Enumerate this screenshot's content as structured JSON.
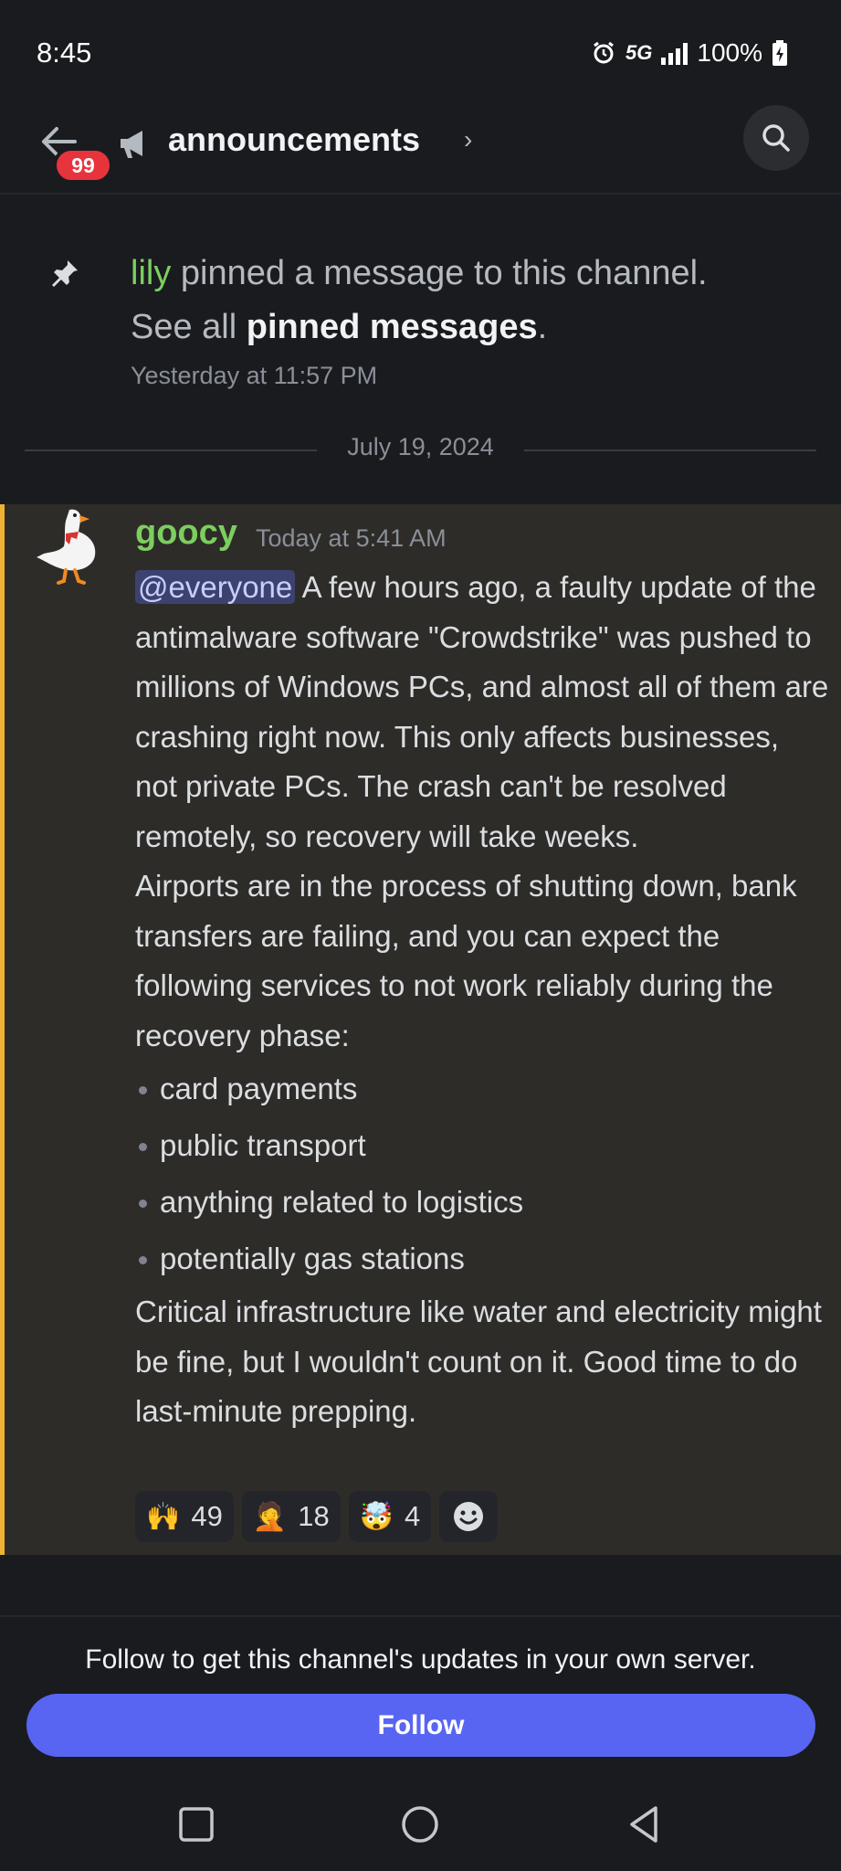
{
  "status_bar": {
    "time": "8:45",
    "network": "5G",
    "battery": "100%"
  },
  "header": {
    "badge_count": "99",
    "channel_name": "announcements",
    "chevron": "›"
  },
  "system_message": {
    "user": "lily",
    "text_1": " pinned a message to this channel.",
    "text_2": "See all ",
    "link": "pinned messages",
    "text_3": ".",
    "time": "Yesterday at 11:57 PM"
  },
  "date_divider": "July 19, 2024",
  "message": {
    "author": "goocy",
    "timestamp": "Today at 5:41 AM",
    "mention": "@everyone",
    "paragraph_1": " A few hours ago, a faulty update of the antimalware software \"Crowdstrike\" was pushed to millions of Windows PCs, and almost all of them are crashing right now. This only affects businesses, not private PCs. The crash can't be resolved remotely, so recovery will take weeks.",
    "paragraph_2": "Airports are in the process of shutting down, bank transfers are failing, and you can expect the following services to not work reliably during the recovery phase:",
    "bullets": [
      "card payments",
      "public transport",
      "anything related to logistics",
      "potentially gas stations"
    ],
    "paragraph_3": "Critical infrastructure like water and electricity might be fine, but I wouldn't count on it. Good time to do last-minute prepping.",
    "reactions": [
      {
        "emoji": "🙌",
        "count": "49"
      },
      {
        "emoji": "🤦",
        "count": "18"
      },
      {
        "emoji": "🤯",
        "count": "4"
      }
    ],
    "add_reaction_icon": "smiley-icon"
  },
  "footer": {
    "prompt": "Follow to get this channel's updates in your own server.",
    "follow_label": "Follow"
  },
  "colors": {
    "background": "#1a1b1f",
    "mention_highlight": "#2e2c29",
    "mention_bar": "#f0b232",
    "username_green": "#7ccf5f",
    "blurple": "#5865f2",
    "badge_red": "#e7343c"
  }
}
